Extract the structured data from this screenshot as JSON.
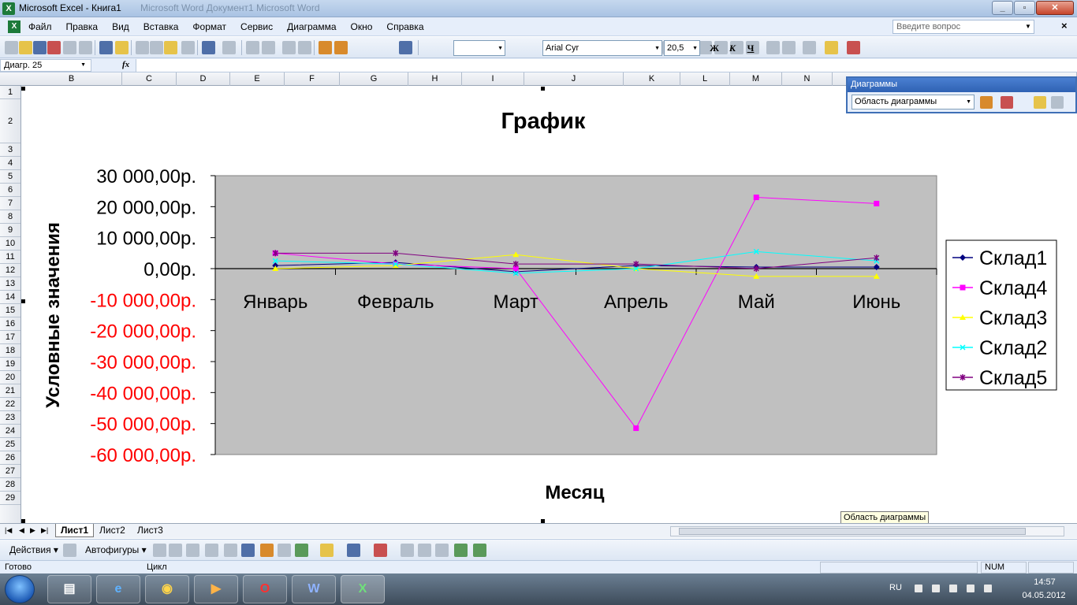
{
  "window": {
    "title": "Microsoft Excel - Книга1",
    "ghost_title": "Microsoft Word   Документ1   Microsoft Word"
  },
  "menu": {
    "items": [
      "Файл",
      "Правка",
      "Вид",
      "Вставка",
      "Формат",
      "Сервис",
      "Диаграмма",
      "Окно",
      "Справка"
    ],
    "help_placeholder": "Введите вопрос"
  },
  "toolbar": {
    "font_name": "Arial Cyr",
    "font_size": "20,5",
    "bold_label": "Ж",
    "italic_label": "К",
    "underline_label": "Ч"
  },
  "formula_bar": {
    "name_box": "Диагр. 25",
    "fx_label": "fx"
  },
  "columns": [
    "B",
    "C",
    "D",
    "E",
    "F",
    "G",
    "H",
    "I",
    "J",
    "K",
    "L",
    "M",
    "N"
  ],
  "rows": [
    "1",
    "2",
    "3",
    "4",
    "5",
    "6",
    "7",
    "8",
    "9",
    "10",
    "11",
    "12",
    "13",
    "14",
    "15",
    "16",
    "17",
    "18",
    "19",
    "20",
    "21",
    "22",
    "23",
    "24",
    "25",
    "26",
    "27",
    "28",
    "29"
  ],
  "chart_toolbar": {
    "caption": "Диаграммы",
    "selected_element": "Область диаграммы"
  },
  "tooltip": "Область диаграммы",
  "sheet_tabs": [
    "Лист1",
    "Лист2",
    "Лист3"
  ],
  "drawing_toolbar": {
    "actions_label": "Действия",
    "autoshapes_label": "Автофигуры"
  },
  "status": {
    "ready": "Готово",
    "mode": "Цикл",
    "num": "NUM"
  },
  "taskbar": {
    "lang": "RU",
    "time": "14:57",
    "date": "04.05.2012"
  },
  "chart_data": {
    "type": "line",
    "title": "График",
    "xlabel": "Месяц",
    "ylabel": "Условные значения",
    "categories": [
      "Январь",
      "Февраль",
      "Март",
      "Апрель",
      "Май",
      "Июнь"
    ],
    "ylim": [
      -60000,
      30000
    ],
    "yticks": [
      30000,
      20000,
      10000,
      0,
      -10000,
      -20000,
      -30000,
      -40000,
      -50000,
      -60000
    ],
    "ytick_labels": [
      "30 000,00р.",
      "20 000,00р.",
      "10 000,00р.",
      "0,00р.",
      "-10 000,00р.",
      "-20 000,00р.",
      "-30 000,00р.",
      "-40 000,00р.",
      "-50 000,00р.",
      "-60 000,00р."
    ],
    "negative_tick_color": "#ff0000",
    "plot_background": "#c0c0c0",
    "legend_position": "right",
    "series": [
      {
        "name": "Склад1",
        "color": "#000080",
        "marker": "diamond",
        "values": [
          1000,
          2000,
          -1000,
          1000,
          500,
          500
        ]
      },
      {
        "name": "Склад4",
        "color": "#ff00ff",
        "marker": "square",
        "values": [
          5000,
          1500,
          0,
          -51500,
          23000,
          21000
        ]
      },
      {
        "name": "Склад3",
        "color": "#ffff00",
        "marker": "triangle",
        "values": [
          0,
          1000,
          4500,
          0,
          -2500,
          -2500
        ]
      },
      {
        "name": "Склад2",
        "color": "#00ffff",
        "marker": "x",
        "values": [
          2500,
          1500,
          -1500,
          0,
          5500,
          2500
        ]
      },
      {
        "name": "Склад5",
        "color": "#800080",
        "marker": "star",
        "values": [
          5000,
          5000,
          1500,
          1500,
          0,
          3500
        ]
      }
    ]
  }
}
